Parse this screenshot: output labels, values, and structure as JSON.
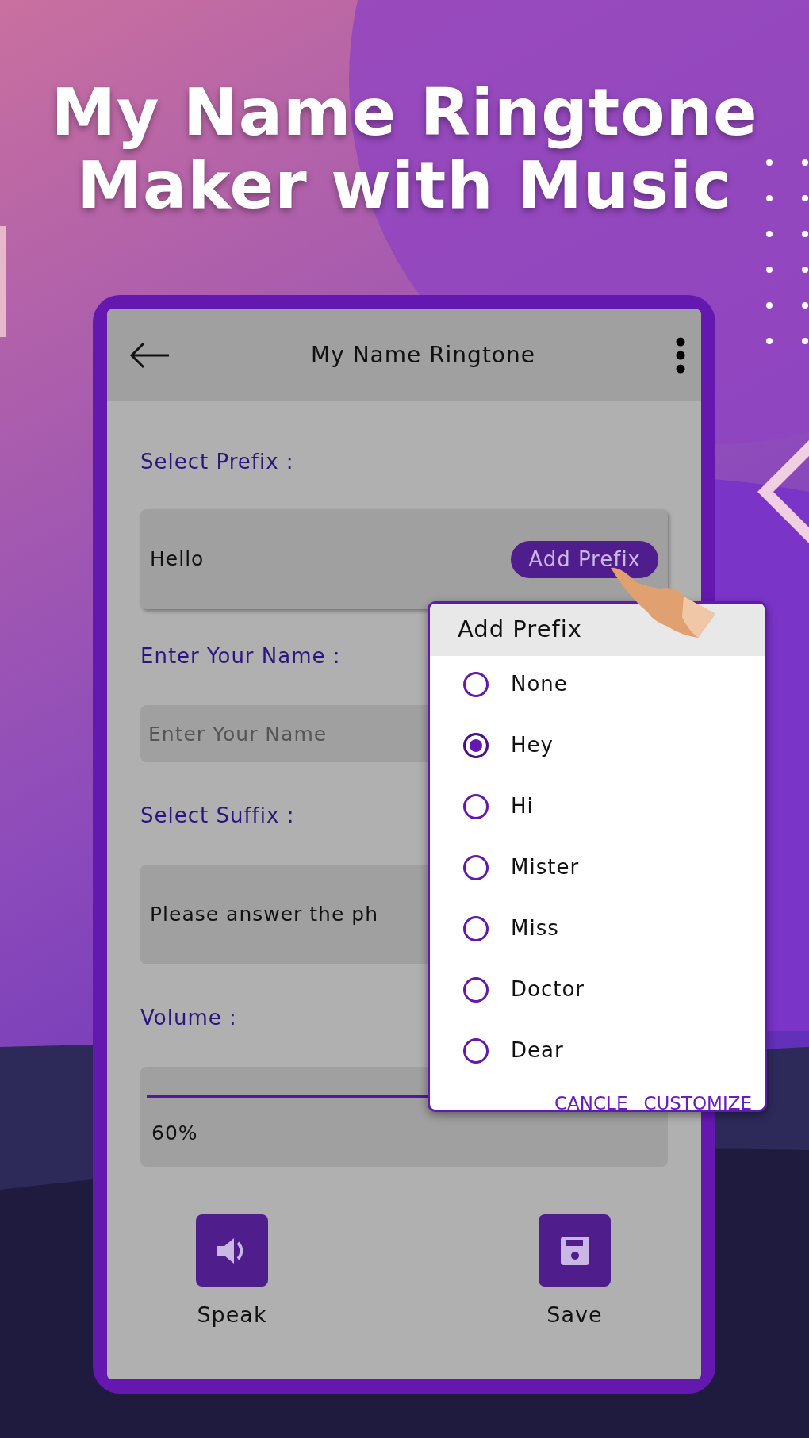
{
  "headline": [
    "My Name Ringtone",
    "Maker with Music"
  ],
  "app_bar": {
    "title": "My Name Ringtone"
  },
  "prefix": {
    "label": "Select Prefix :",
    "value": "Hello",
    "button": "Add Prefix"
  },
  "name": {
    "label": "Enter Your Name :",
    "placeholder": "Enter Your Name"
  },
  "suffix": {
    "label": "Select Suffix :",
    "value": "Please answer the ph"
  },
  "volume": {
    "label": "Volume :",
    "level": 0.6,
    "reading": "60%"
  },
  "actions": [
    {
      "label": "Speak",
      "kind": "speak"
    },
    {
      "label": "Save",
      "kind": "save"
    }
  ],
  "dialog": {
    "title": "Add Prefix",
    "options": [
      {
        "label": "None",
        "selected": false
      },
      {
        "label": "Hey",
        "selected": true
      },
      {
        "label": "Hi",
        "selected": false
      },
      {
        "label": "Mister",
        "selected": false
      },
      {
        "label": "Miss",
        "selected": false
      },
      {
        "label": "Doctor",
        "selected": false
      },
      {
        "label": "Dear",
        "selected": false
      }
    ],
    "buttons": [
      "CANCLE",
      "CUSTOMIZE"
    ]
  }
}
